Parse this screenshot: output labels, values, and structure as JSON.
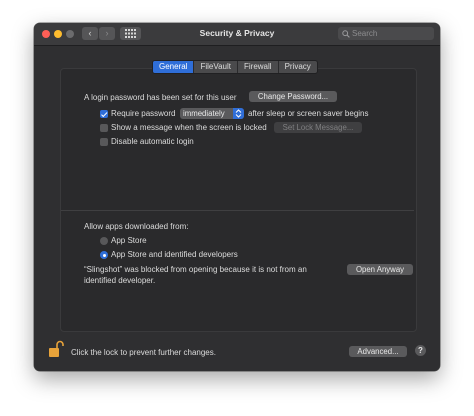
{
  "window": {
    "title": "Security & Privacy"
  },
  "toolbar": {
    "back": "‹",
    "forward": "›",
    "search_placeholder": "Search"
  },
  "tabs": [
    {
      "label": "General",
      "active": true
    },
    {
      "label": "FileVault",
      "active": false
    },
    {
      "label": "Firewall",
      "active": false
    },
    {
      "label": "Privacy",
      "active": false
    }
  ],
  "general": {
    "login_password_text": "A login password has been set for this user",
    "change_password_label": "Change Password...",
    "require_password": {
      "label": "Require password",
      "checked": true,
      "selected_value": "immediately",
      "suffix": "after sleep or screen saver begins"
    },
    "show_message": {
      "label": "Show a message when the screen is locked",
      "checked": false,
      "button_label": "Set Lock Message..."
    },
    "disable_autologin": {
      "label": "Disable automatic login",
      "checked": false
    }
  },
  "allow_apps": {
    "heading": "Allow apps downloaded from:",
    "options": [
      {
        "label": "App Store",
        "selected": false
      },
      {
        "label": "App Store and identified developers",
        "selected": true
      }
    ],
    "blocked_line1": "“Slingshot” was blocked from opening because it is not from an",
    "blocked_line2": "identified developer.",
    "open_anyway_label": "Open Anyway"
  },
  "footer": {
    "lock_text": "Click the lock to prevent further changes.",
    "advanced_label": "Advanced...",
    "help_label": "?"
  },
  "colors": {
    "accent": "#2f6ed8",
    "window_bg": "#2f2f31",
    "lock": "#e8a33a"
  }
}
